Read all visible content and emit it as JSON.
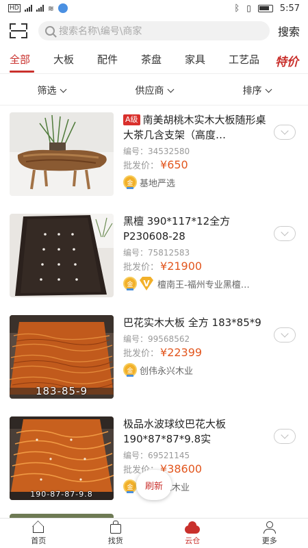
{
  "status": {
    "network_label": "HD",
    "time": "5:57"
  },
  "search": {
    "placeholder": "搜索名称\\编号\\商家",
    "button_label": "搜索"
  },
  "categories": [
    {
      "label": "全部",
      "active": true
    },
    {
      "label": "大板",
      "active": false
    },
    {
      "label": "配件",
      "active": false
    },
    {
      "label": "茶盘",
      "active": false
    },
    {
      "label": "家具",
      "active": false
    },
    {
      "label": "工艺品",
      "active": false
    }
  ],
  "special_tab": "特价",
  "filters": [
    {
      "label": "筛选"
    },
    {
      "label": "供应商"
    },
    {
      "label": "排序"
    }
  ],
  "products": [
    {
      "grade": "A级",
      "title": "南美胡桃木实木大板随形桌大茶几含支架（高度…",
      "code_label": "编号：",
      "code": "34532580",
      "price_label": "批发价：",
      "price": "¥650",
      "seller": "基地严选",
      "has_v_badge": false,
      "thumb_caption": ""
    },
    {
      "grade": "",
      "title": "黑檀 390*117*12全方 P230608-28",
      "code_label": "编号：",
      "code": "75812583",
      "price_label": "批发价：",
      "price": "¥21900",
      "seller": "檀南王-福州专业黑檀…",
      "has_v_badge": true,
      "thumb_caption": ""
    },
    {
      "grade": "",
      "title": "巴花实木大板 全方 183*85*9",
      "code_label": "编号：",
      "code": "99568562",
      "price_label": "批发价：",
      "price": "¥22399",
      "seller": "创伟永兴木业",
      "has_v_badge": false,
      "thumb_caption": "183-85-9"
    },
    {
      "grade": "",
      "title": "极品水波球纹巴花大板 190*87*87*9.8实",
      "code_label": "编号：",
      "code": "69521145",
      "price_label": "批发价：",
      "price": "¥38600",
      "seller": "龙木业",
      "has_v_badge": false,
      "thumb_caption": "190-87-87-9.8"
    }
  ],
  "medal_text": "金",
  "v_text": "V",
  "refresh_label": "刷新",
  "bottom_nav": [
    {
      "label": "首页",
      "icon": "home-icon",
      "active": false
    },
    {
      "label": "找货",
      "icon": "bag-icon",
      "active": false
    },
    {
      "label": "云仓",
      "icon": "cloud-icon",
      "active": true
    },
    {
      "label": "更多",
      "icon": "user-icon",
      "active": false
    }
  ],
  "colors": {
    "accent": "#c9302c",
    "price": "#e2561e",
    "medal": "#f2b02a"
  }
}
